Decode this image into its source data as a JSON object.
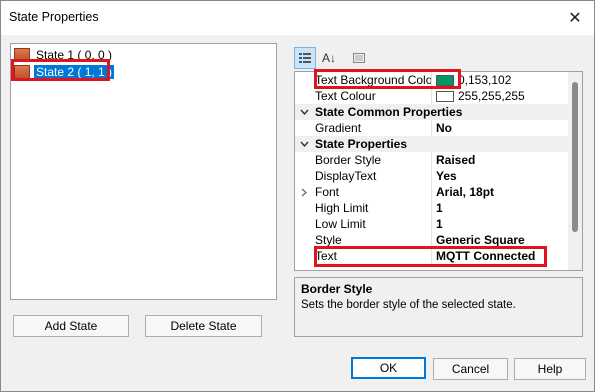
{
  "window": {
    "title": "State Properties",
    "close_glyph": "✕"
  },
  "tree": {
    "items": [
      {
        "label": "State 1 ( 0, 0 )",
        "selected": false
      },
      {
        "label": "State 2 ( 1, 1 )",
        "selected": true
      }
    ]
  },
  "buttons": {
    "add_state": "Add State",
    "delete_state": "Delete State",
    "ok": "OK",
    "cancel": "Cancel",
    "help": "Help"
  },
  "toolbar": {
    "categorized_icon": "categorized-icon",
    "alphabetical_icon": "alphabetical-icon",
    "pages_icon": "property-pages-icon",
    "sort_glyph": "A↓"
  },
  "properties": {
    "rows": [
      {
        "kind": "prop",
        "name": "Text Background Colo",
        "value": "0,153,102",
        "swatch": "#009966"
      },
      {
        "kind": "prop",
        "name": "Text Colour",
        "value": "255,255,255",
        "swatch": "#ffffff"
      },
      {
        "kind": "cat",
        "name": "State Common Properties"
      },
      {
        "kind": "prop",
        "name": "Gradient",
        "value": "No"
      },
      {
        "kind": "cat",
        "name": "State Properties"
      },
      {
        "kind": "prop",
        "name": "Border Style",
        "value": "Raised"
      },
      {
        "kind": "prop",
        "name": "DisplayText",
        "value": "Yes"
      },
      {
        "kind": "prop",
        "name": "Font",
        "value": "Arial, 18pt",
        "expandable": true
      },
      {
        "kind": "prop",
        "name": "High Limit",
        "value": "1"
      },
      {
        "kind": "prop",
        "name": "Low Limit",
        "value": "1"
      },
      {
        "kind": "prop",
        "name": "Style",
        "value": "Generic Square"
      },
      {
        "kind": "prop",
        "name": "Text",
        "value": "MQTT Connected"
      }
    ]
  },
  "description": {
    "title": "Border Style",
    "text": "Sets the border style of the selected state."
  },
  "colors": {
    "highlight": "#e0141e",
    "selection": "#0078d7"
  }
}
